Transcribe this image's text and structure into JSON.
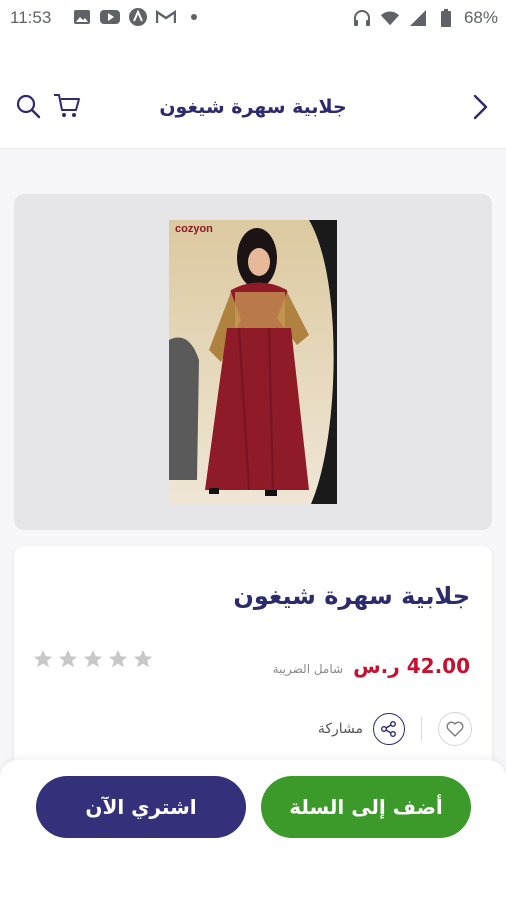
{
  "status_bar": {
    "time": "11:53",
    "battery": "68%"
  },
  "header": {
    "title": "جلابية سهرة شيغون"
  },
  "product_image": {
    "brand_watermark": "cozyon"
  },
  "product": {
    "name": "جلابية سهرة شيغون",
    "price": "42.00 ر.س",
    "tax_note": "شامل الضريبة",
    "rating_stars": 0,
    "rating_max": 5,
    "share_label": "مشاركة"
  },
  "actions": {
    "add_to_cart": "أضف إلى السلة",
    "buy_now": "اشتري الآن"
  },
  "colors": {
    "primary": "#35307a",
    "accent_green": "#3c9a2a",
    "price_red": "#c8102e"
  }
}
